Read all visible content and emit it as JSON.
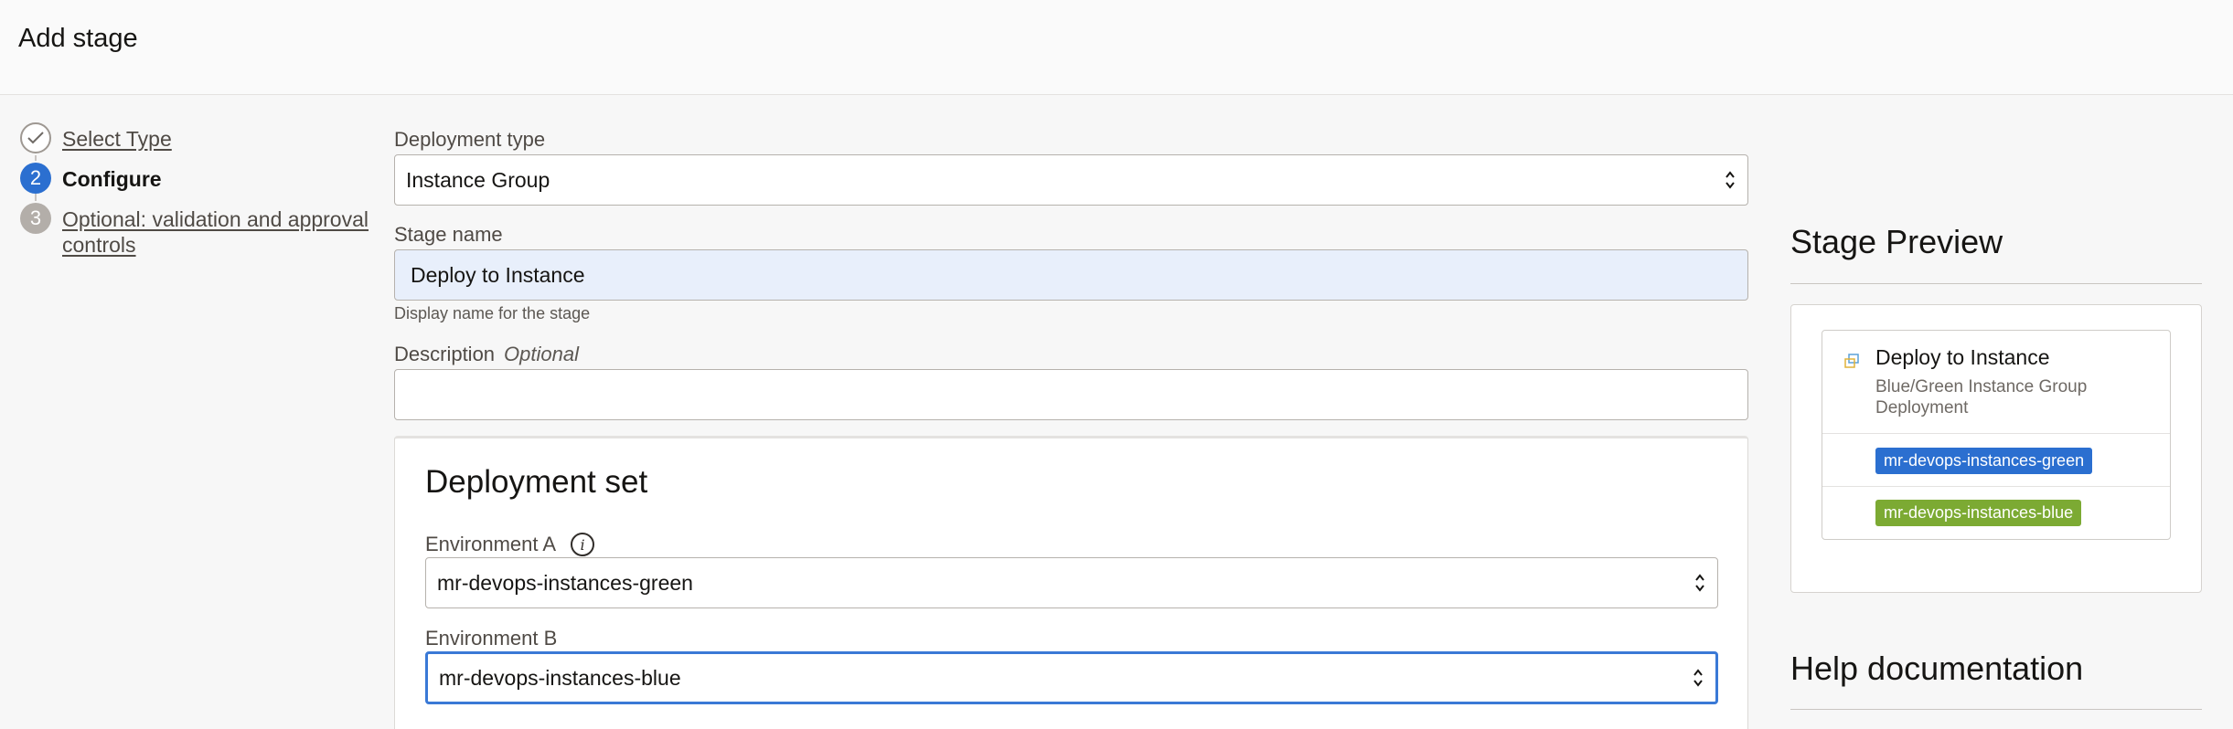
{
  "header": {
    "title": "Add stage"
  },
  "steps": [
    {
      "number": "",
      "label": "Select Type",
      "state": "completed"
    },
    {
      "number": "2",
      "label": "Configure",
      "state": "current"
    },
    {
      "number": "3",
      "label_line1": "Optional: validation and approval",
      "label_line2": "controls",
      "state": "upcoming"
    }
  ],
  "form": {
    "deployment_type": {
      "label": "Deployment type",
      "value": "Instance Group"
    },
    "stage_name": {
      "label": "Stage name",
      "value": "Deploy to Instance",
      "help": "Display name for the stage"
    },
    "description": {
      "label": "Description",
      "optional": "Optional",
      "value": ""
    },
    "deployment_set": {
      "title": "Deployment set",
      "env_a": {
        "label": "Environment A",
        "value": "mr-devops-instances-green"
      },
      "env_b": {
        "label": "Environment B",
        "value": "mr-devops-instances-blue"
      }
    }
  },
  "preview": {
    "title": "Stage Preview",
    "stage_name": "Deploy to Instance",
    "stage_desc": "Blue/Green Instance Group Deployment",
    "badges": [
      {
        "text": "mr-devops-instances-green",
        "color": "#2b6fd0"
      },
      {
        "text": "mr-devops-instances-blue",
        "color": "#7caa33"
      }
    ]
  },
  "help": {
    "title": "Help documentation"
  },
  "colors": {
    "accent": "#2b6fd0",
    "focus": "#3a79d6",
    "stage_name_bg": "#e8effb"
  }
}
